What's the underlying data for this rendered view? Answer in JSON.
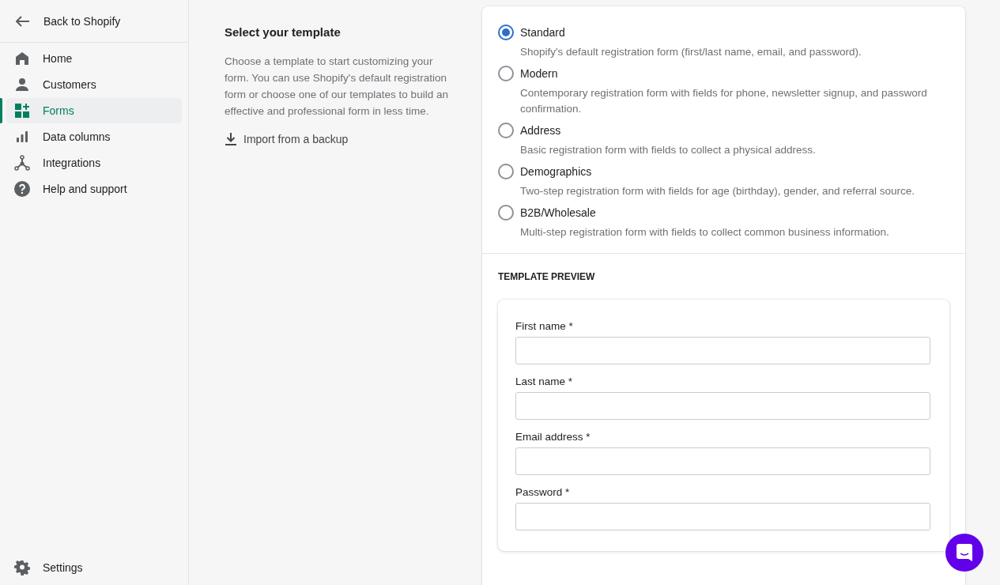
{
  "sidebar": {
    "back": "Back to Shopify",
    "items": [
      {
        "kind": "home",
        "label": "Home",
        "selected": false
      },
      {
        "kind": "customers",
        "label": "Customers",
        "selected": false
      },
      {
        "kind": "forms",
        "label": "Forms",
        "selected": true
      },
      {
        "kind": "columns",
        "label": "Data columns",
        "selected": false
      },
      {
        "kind": "integrations",
        "label": "Integrations",
        "selected": false
      },
      {
        "kind": "help",
        "label": "Help and support",
        "selected": false
      }
    ],
    "settings": "Settings"
  },
  "intro": {
    "title": "Select your template",
    "description": "Choose a template to start customizing your form. You can use Shopify's default registration form or choose one of our templates to build an effective and professional form in less time.",
    "import_link": "Import from a backup"
  },
  "templates": [
    {
      "name": "Standard",
      "description": "Shopify's default registration form (first/last name, email, and password).",
      "selected": true
    },
    {
      "name": "Modern",
      "description": "Contemporary registration form with fields for phone, newsletter signup, and password confirmation.",
      "selected": false
    },
    {
      "name": "Address",
      "description": "Basic registration form with fields to collect a physical address.",
      "selected": false
    },
    {
      "name": "Demographics",
      "description": "Two-step registration form with fields for age (birthday), gender, and referral source.",
      "selected": false
    },
    {
      "name": "B2B/Wholesale",
      "description": "Multi-step registration form with fields to collect common business information.",
      "selected": false
    }
  ],
  "preview": {
    "heading": "TEMPLATE PREVIEW",
    "fields": [
      {
        "label": "First name *"
      },
      {
        "label": "Last name *"
      },
      {
        "label": "Email address *"
      },
      {
        "label": "Password *"
      }
    ]
  }
}
